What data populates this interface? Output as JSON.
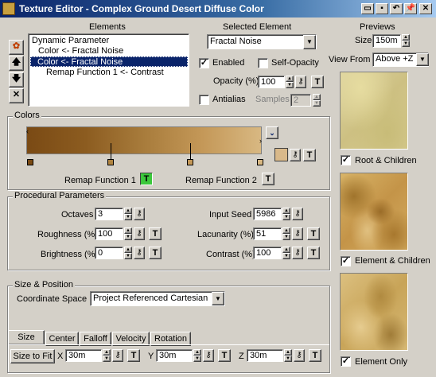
{
  "window": {
    "title": "Texture Editor - Complex Ground Desert Diffuse Color",
    "buttons": [
      "folder-icon",
      "save-icon",
      "undo-icon",
      "pin-icon",
      "close-icon"
    ]
  },
  "elements": {
    "header": "Elements",
    "items": [
      {
        "label": "Dynamic Parameter",
        "indent": 0,
        "selected": false
      },
      {
        "label": "Color  <- Fractal Noise",
        "indent": 1,
        "selected": false
      },
      {
        "label": "Color  <- Fractal Noise",
        "indent": 1,
        "selected": true
      },
      {
        "label": "Remap Function 1  <- Contrast",
        "indent": 2,
        "selected": false
      }
    ],
    "side_buttons": [
      "add-icon",
      "up-arrow-icon",
      "down-arrow-icon",
      "delete-icon"
    ]
  },
  "selected_element": {
    "header": "Selected Element",
    "type_value": "Fractal Noise",
    "enabled_label": "Enabled",
    "enabled_checked": true,
    "self_opacity_label": "Self-Opacity",
    "self_opacity_checked": false,
    "opacity_label": "Opacity (%)",
    "opacity_value": "100",
    "antialias_label": "Antialias",
    "antialias_checked": false,
    "samples_label": "Samples",
    "samples_value": "2"
  },
  "previews": {
    "header": "Previews",
    "size_label": "Size",
    "size_value": "150m",
    "view_from_label": "View From",
    "view_from_value": "Above +Z",
    "items": [
      {
        "label": "Root & Children",
        "checked": true
      },
      {
        "label": "Element & Children",
        "checked": true
      },
      {
        "label": "Element Only",
        "checked": true
      }
    ]
  },
  "colors": {
    "group_label": "Colors",
    "remap1_label": "Remap Function 1",
    "remap1_button": "T",
    "remap2_label": "Remap Function 2",
    "remap2_button": "T",
    "swatch_color": "#d9b98a",
    "swatch_button": "T"
  },
  "procedural": {
    "group_label": "Procedural Parameters",
    "octaves_label": "Octaves",
    "octaves_value": "3",
    "roughness_label": "Roughness (%)",
    "roughness_value": "100",
    "brightness_label": "Brightness (%)",
    "brightness_value": "0",
    "input_seed_label": "Input Seed",
    "input_seed_value": "5986",
    "lacunarity_label": "Lacunarity (%)",
    "lacunarity_value": "51",
    "contrast_label": "Contrast (%)",
    "contrast_value": "100",
    "t_label": "T"
  },
  "size_position": {
    "group_label": "Size & Position",
    "coord_label": "Coordinate Space",
    "coord_value": "Project Referenced Cartesian",
    "tabs": [
      "Size",
      "Center",
      "Falloff",
      "Velocity",
      "Rotation"
    ],
    "size_to_fit_label": "Size to Fit",
    "x_label": "X",
    "x_value": "30m",
    "y_label": "Y",
    "y_value": "30m",
    "z_label": "Z",
    "z_value": "30m",
    "t_label": "T"
  },
  "colors_palette": {
    "title_start": "#0a246a",
    "title_end": "#a6caf0",
    "face": "#d4d0c8",
    "selection": "#0a246a",
    "remap_active": "#3cc83c"
  }
}
